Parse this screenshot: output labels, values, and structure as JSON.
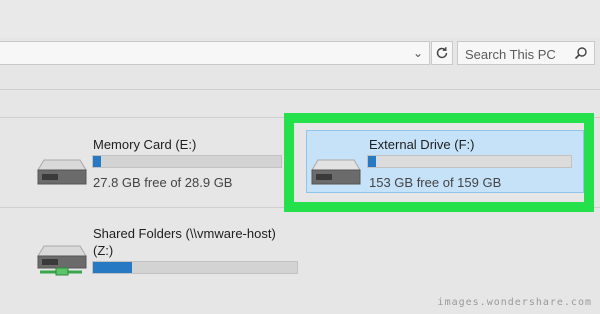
{
  "toolbar": {
    "search_placeholder": "Search This PC",
    "address_chevron": "⌄"
  },
  "drives": [
    {
      "name": "Memory Card (E:)",
      "free_text": "27.8 GB free of 28.9 GB",
      "used_fraction": 0.04,
      "icon": "hard-drive-icon"
    },
    {
      "name": "External Drive (F:)",
      "free_text": "153 GB free of 159 GB",
      "used_fraction": 0.04,
      "selected": true,
      "icon": "hard-drive-icon"
    },
    {
      "name_line1": "Shared Folders (\\\\vmware-host)",
      "name_line2": "(Z:)",
      "used_fraction": 0.19,
      "icon": "network-drive-icon"
    }
  ],
  "colors": {
    "usage_fill": "#2679c2",
    "highlight": "#24e04a",
    "selection": "#c6e2f8"
  },
  "watermark": "images.wondershare.com"
}
